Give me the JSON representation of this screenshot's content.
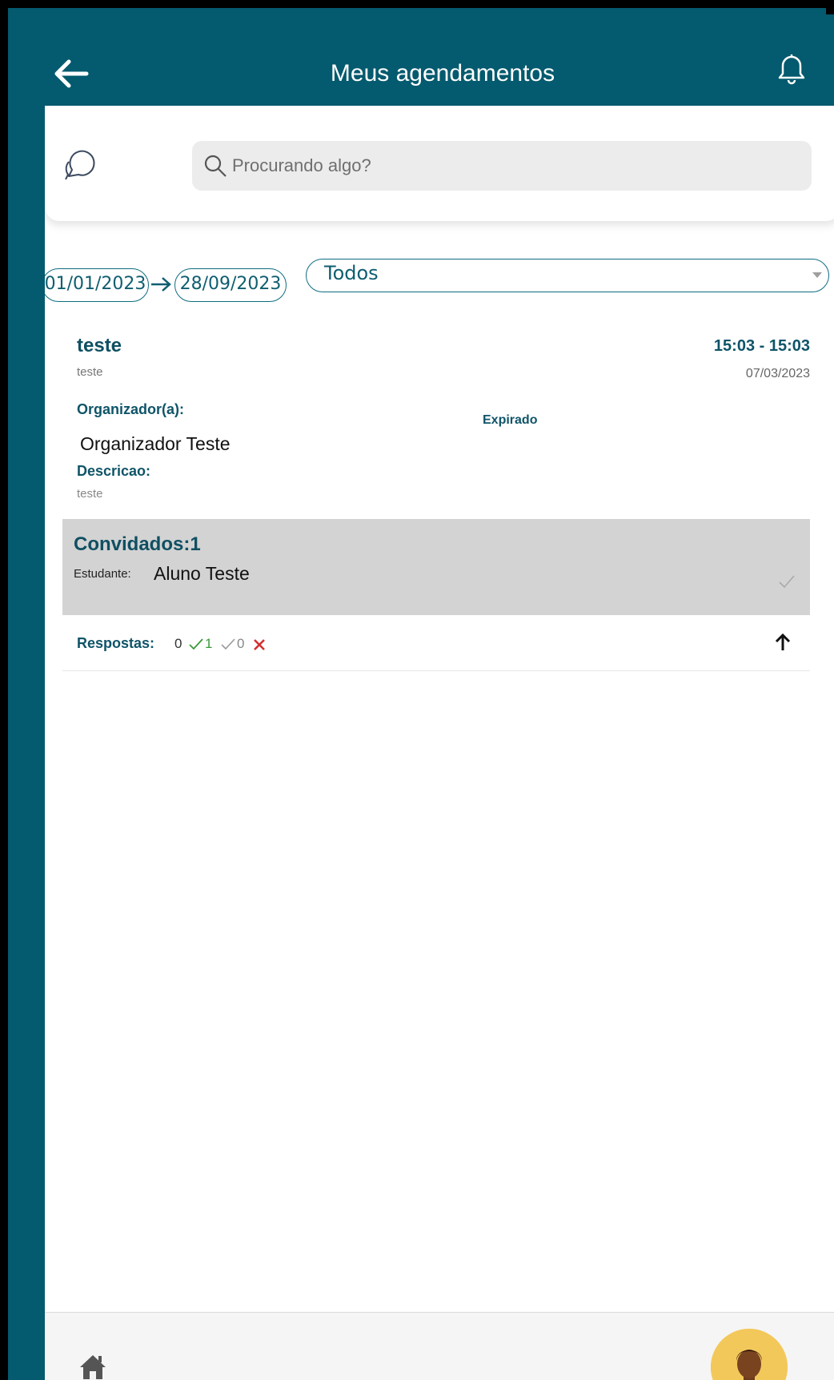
{
  "header": {
    "title": "Meus agendamentos",
    "back_icon": "arrow-left-icon",
    "bell_icon": "bell-icon"
  },
  "search": {
    "placeholder": "Procurando algo?"
  },
  "filters": {
    "date_start": "01/01/2023",
    "date_end": "28/09/2023",
    "select_value": "Todos"
  },
  "event": {
    "title": "teste",
    "subtitle": "teste",
    "time": "15:03 - 15:03",
    "date": "07/03/2023",
    "organizer_label": "Organizador(a):",
    "organizer_name": "Organizador Teste",
    "status": "Expirado",
    "description_label": "Descricao:",
    "description": "teste"
  },
  "guests": {
    "title": "Convidados:1",
    "role": "Estudante:",
    "name": "Aluno Teste"
  },
  "answers": {
    "label": "Respostas:",
    "pending": "0",
    "accepted": "1",
    "seen": "0"
  },
  "colors": {
    "primary": "#045a6e",
    "accent_text": "#0f5468",
    "panel": "#d3d3d3",
    "accept": "#3a9a3a",
    "reject": "#d32f2f"
  }
}
